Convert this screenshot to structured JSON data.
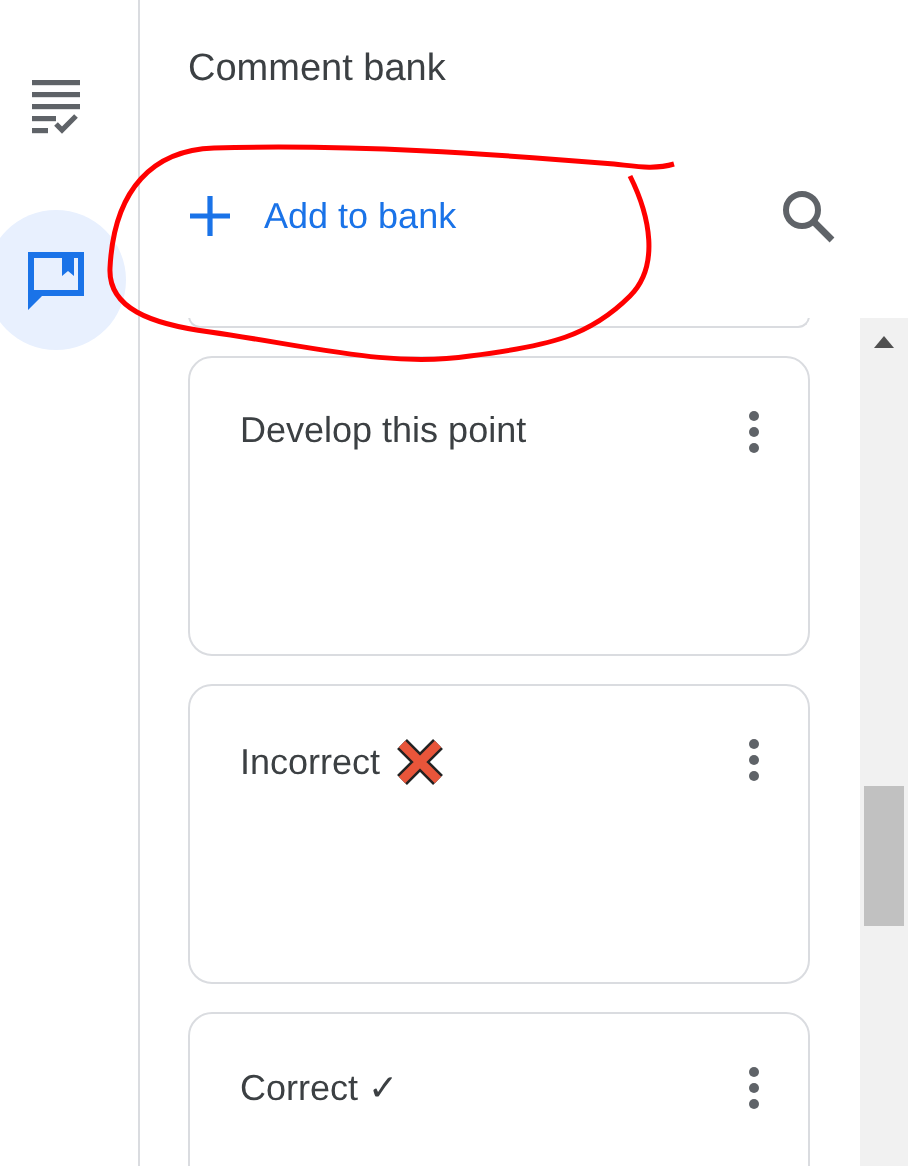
{
  "rail": [
    {
      "kind": "checklist",
      "selected": false
    },
    {
      "kind": "comment",
      "selected": true
    }
  ],
  "panel": {
    "title": "Comment bank",
    "add_label": "Add to bank"
  },
  "comments": [
    {
      "text": "Develop this point",
      "kind": "plain"
    },
    {
      "text": "Incorrect",
      "kind": "cross"
    },
    {
      "text": "Correct ✓",
      "kind": "plain"
    }
  ]
}
